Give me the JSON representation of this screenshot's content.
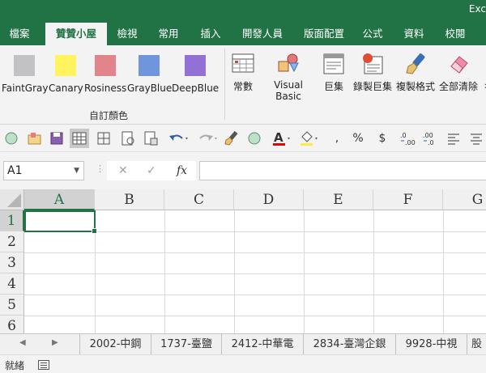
{
  "window": {
    "app_title": "Exc"
  },
  "ribbon_tabs": [
    {
      "label": "檔案"
    },
    {
      "label": "贊贊小屋"
    },
    {
      "label": "檢視"
    },
    {
      "label": "常用"
    },
    {
      "label": "插入"
    },
    {
      "label": "開發人員"
    },
    {
      "label": "版面配置"
    },
    {
      "label": "公式"
    },
    {
      "label": "資料"
    },
    {
      "label": "校閱"
    }
  ],
  "custom_colors": {
    "group_label": "自訂顏色",
    "items": [
      {
        "label": "FaintGray",
        "color": "#c2c2c4"
      },
      {
        "label": "Canary",
        "color": "#fff35e"
      },
      {
        "label": "Rosiness",
        "color": "#e2858b"
      },
      {
        "label": "GrayBlue",
        "color": "#6f96dc"
      },
      {
        "label": "DeepBlue",
        "color": "#9370d5"
      }
    ]
  },
  "commands": [
    {
      "label": "常數",
      "icon": "table-icon"
    },
    {
      "label": "Visual Basic",
      "icon": "shapes-icon"
    },
    {
      "label": "巨集",
      "icon": "macro-icon"
    },
    {
      "label": "錄製巨集",
      "icon": "record-macro-icon"
    },
    {
      "label": "複製格式",
      "icon": "format-painter-icon"
    },
    {
      "label": "全部清除",
      "icon": "eraser-icon"
    },
    {
      "label": "彳",
      "icon": "more-icon"
    }
  ],
  "quick_access": {
    "percent": "%",
    "currency": "$",
    "comma": ","
  },
  "formula_bar": {
    "name_box": "A1",
    "cancel": "✕",
    "enter": "✓",
    "fx": "fx",
    "formula": ""
  },
  "grid": {
    "columns": [
      "A",
      "B",
      "C",
      "D",
      "E",
      "F",
      "G"
    ],
    "rows": [
      "1",
      "2",
      "3",
      "4",
      "5",
      "6"
    ],
    "selected_cell": "A1"
  },
  "sheets": [
    {
      "label": "2002-中鋼"
    },
    {
      "label": "1737-臺鹽"
    },
    {
      "label": "2412-中華電"
    },
    {
      "label": "2834-臺灣企銀"
    },
    {
      "label": "9928-中視"
    },
    {
      "label": "股"
    }
  ],
  "status": {
    "text": "就緒"
  }
}
